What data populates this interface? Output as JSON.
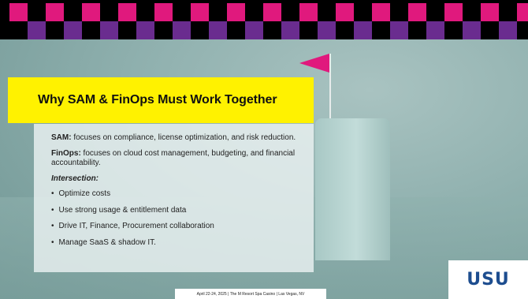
{
  "colors": {
    "banner_top": "#e0197d",
    "banner_bottom": "#6a2c8f",
    "title_bar": "#fff200",
    "flag": "#e0197d",
    "logo": "#1d4d8f"
  },
  "title": "Why SAM & FinOps Must Work Together",
  "sam": {
    "label": "SAM:",
    "text": " focuses on compliance, license optimization, and risk reduction."
  },
  "finops": {
    "label": "FinOps:",
    "text": " focuses on cloud cost management, budgeting, and financial accountability."
  },
  "intersection_label": "Intersection:",
  "bullets": [
    "Optimize costs",
    "Use strong usage & entitlement data",
    "Drive IT, Finance, Procurement collaboration",
    "Manage SaaS & shadow IT."
  ],
  "logo": "USU",
  "footer": "April 22-24, 2025 | The M Resort Spa Casino | Las Vegas, NV"
}
